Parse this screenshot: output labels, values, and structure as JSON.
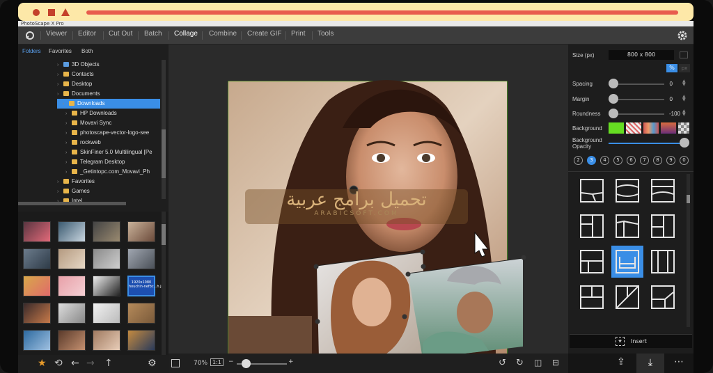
{
  "browser": {
    "dots": [
      "circle",
      "square",
      "triangle"
    ]
  },
  "app": {
    "title": "PhotoScape X Pro"
  },
  "menu": {
    "items": [
      "Viewer",
      "Editor",
      "Cut Out",
      "Batch",
      "Collage",
      "Combine",
      "Create GIF",
      "Print",
      "Tools"
    ],
    "active": "Collage"
  },
  "folders": {
    "tabs": [
      "Folders",
      "Favorites",
      "Both"
    ],
    "tree": [
      "3D Objects",
      "Contacts",
      "Desktop",
      "Documents",
      "Downloads",
      "HP Downloads",
      "Movavi Sync",
      "photoscape-vector-logo-see",
      "rockweb",
      "SkinFiner 5.0 Multilingual [Pe",
      "Telegram Desktop",
      "_Getintopc.com_Movavi_Ph",
      "Favorites",
      "Games",
      "Intel"
    ],
    "selected": "Downloads"
  },
  "thumb_label": "1920x1080\nhouchin-nefbc...h.jpg",
  "right": {
    "size_label": "Size (px)",
    "size_value": "800 x 800",
    "percent_btn": "%",
    "px_btn": "px",
    "spacing_label": "Spacing",
    "spacing_value": "0",
    "margin_label": "Margin",
    "margin_value": "0",
    "roundness_label": "Roundness",
    "roundness_value": "-100",
    "background_label": "Background",
    "bg_opacity_label": "Background Opacity",
    "counts": [
      "2",
      "3",
      "4",
      "5",
      "6",
      "7",
      "8",
      "9",
      "0"
    ],
    "active_count": "3",
    "insert_label": "Insert"
  },
  "bottom": {
    "zoom": "70%",
    "ratio_btn": "1:1",
    "minus": "−",
    "plus": "+"
  },
  "watermark": {
    "arabic": "تحميل برامج عربية",
    "latin": "ARABICSOFT.COM"
  },
  "colors": {
    "accent": "#3a8ee6",
    "browser_bar": "#fde8a8",
    "url_bar": "#e85b4d",
    "bg_green": "#66dd22"
  }
}
